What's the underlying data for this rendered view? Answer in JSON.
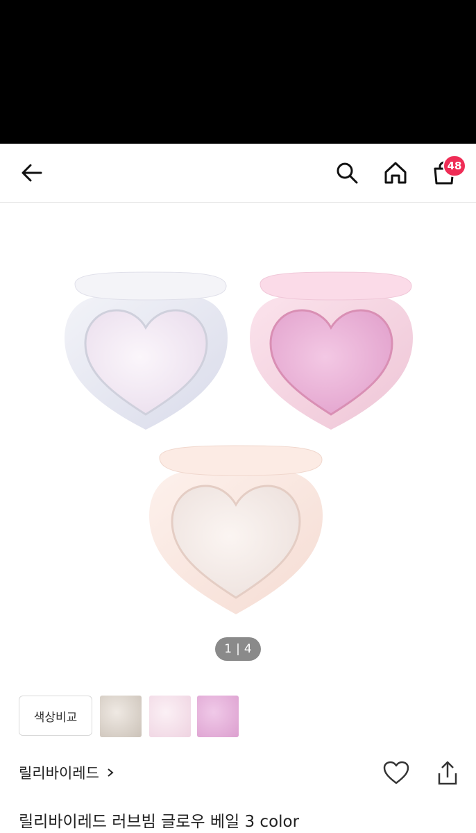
{
  "header": {
    "back_icon": "arrow-left-icon",
    "search_icon": "search-icon",
    "home_icon": "home-icon",
    "cart_icon": "shopping-bag-icon",
    "cart_count": "48",
    "badge_color": "#ef2d56"
  },
  "gallery": {
    "pager_current": "1",
    "pager_sep": "|",
    "pager_total": "4"
  },
  "swatches": {
    "compare_label": "색상비교",
    "colors": [
      "#d8d0c8",
      "#f3dde8",
      "#e6b3dc"
    ]
  },
  "product": {
    "brand": "릴리바이레드",
    "title": "릴리바이레드 러브빔 글로우 베일 3 color"
  }
}
